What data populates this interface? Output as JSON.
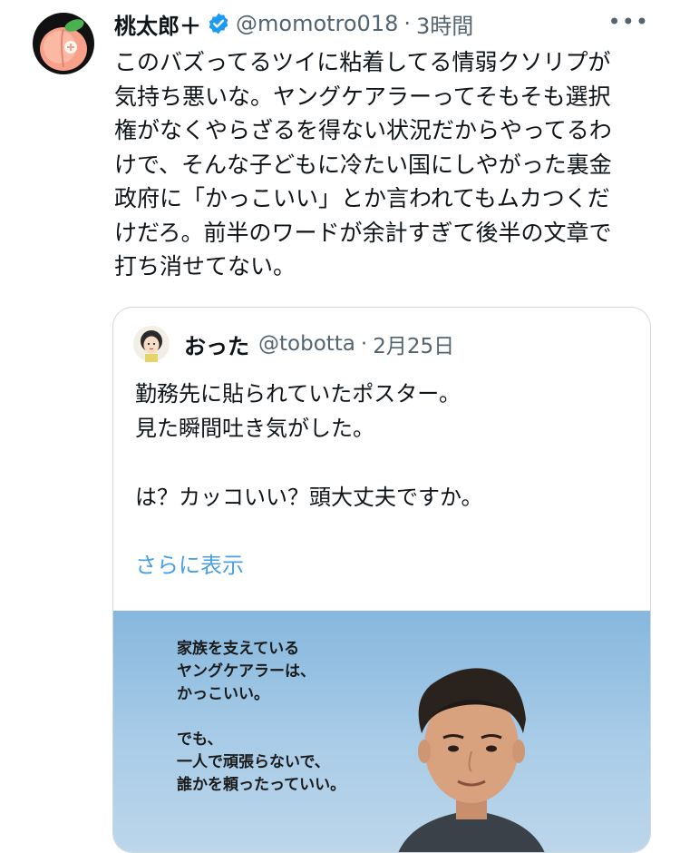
{
  "tweet": {
    "author_name": "桃太郎＋",
    "handle": "@momotro018",
    "separator": "·",
    "time": "3時間",
    "more_icon": "more-dots-icon",
    "lines": [
      "このバズってるツイに粘着してる情弱クソリプが",
      "気持ち悪いな。ヤングケアラーってそもそも選択",
      "権がなくやらざるを得ない状況だからやってるわ",
      "けで、そんな子どもに冷たい国にしやがった裏金",
      "政府に「かっこいい」とか言われてもムカつくだ",
      "けだろ。前半のワードが余計すぎて後半の文章で",
      "打ち消せてない。"
    ]
  },
  "quoted": {
    "author_name": "おった",
    "handle": "@tobotta",
    "separator": "·",
    "date": "2月25日",
    "lines": [
      "勤務先に貼られていたポスター。",
      "見た瞬間吐き気がした。",
      "",
      "は？カッコいい？頭大丈夫ですか。"
    ],
    "show_more": "さらに表示",
    "poster_lines": [
      "家族を支えている",
      "ヤングケアラーは、",
      "かっこいい。",
      "",
      "でも、",
      "一人で頑張らないで、",
      "誰かを頼ったっていい。"
    ]
  },
  "colors": {
    "accent_blue": "#1d9bf0",
    "secondary_text": "#536471",
    "link_blue": "#4a9fe0"
  }
}
